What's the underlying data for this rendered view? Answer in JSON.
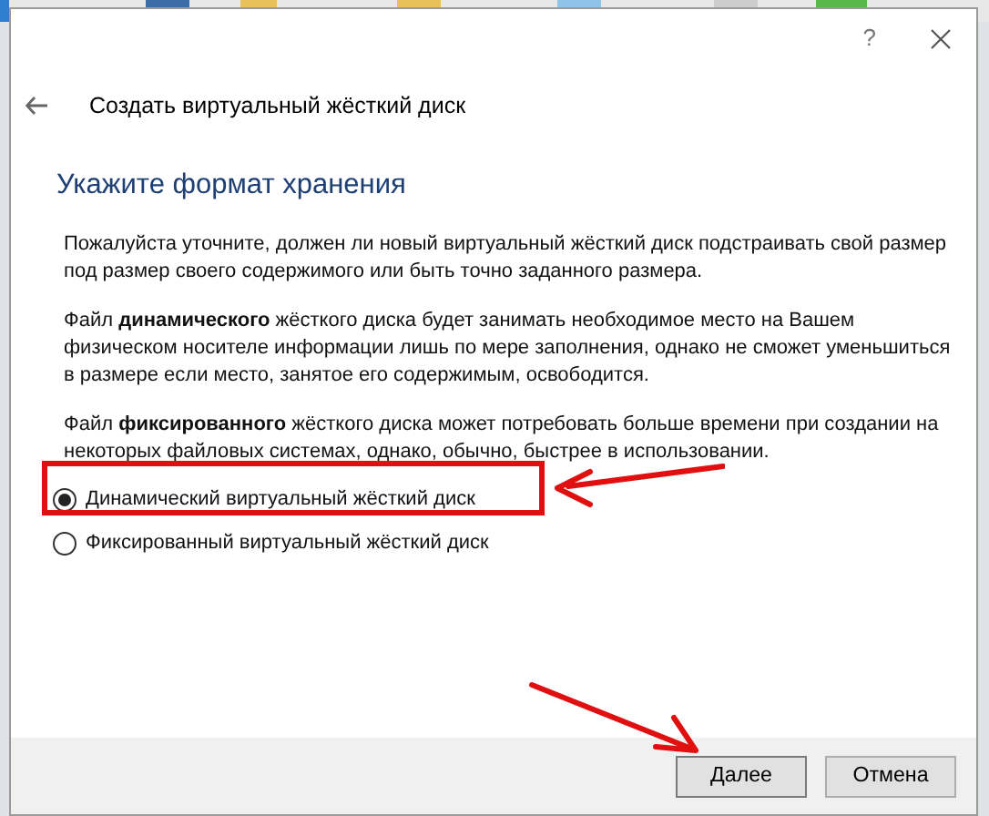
{
  "title_bar": {
    "help": "?"
  },
  "wizard_title": "Создать виртуальный жёсткий диск",
  "heading": "Укажите формат хранения",
  "paragraphs": [
    "Пожалуйста уточните, должен ли новый виртуальный жёсткий диск подстраивать свой размер под размер своего содержимого или быть точно заданного размера.",
    "Файл **динамического** жёсткого диска будет занимать необходимое место на Вашем физическом носителе информации лишь по мере заполнения, однако не сможет уменьшиться в размере если место, занятое его содержимым, освободится.",
    "Файл **фиксированного** жёсткого диска может потребовать больше времени при создании на некоторых файловых системах, однако, обычно, быстрее в использовании."
  ],
  "options": [
    {
      "label": "Динамический виртуальный жёсткий диск",
      "selected": true
    },
    {
      "label": "Фиксированный виртуальный жёсткий диск",
      "selected": false
    }
  ],
  "buttons": [
    {
      "label": "Далее",
      "kind": "default"
    },
    {
      "label": "Отмена",
      "kind": "normal"
    }
  ]
}
